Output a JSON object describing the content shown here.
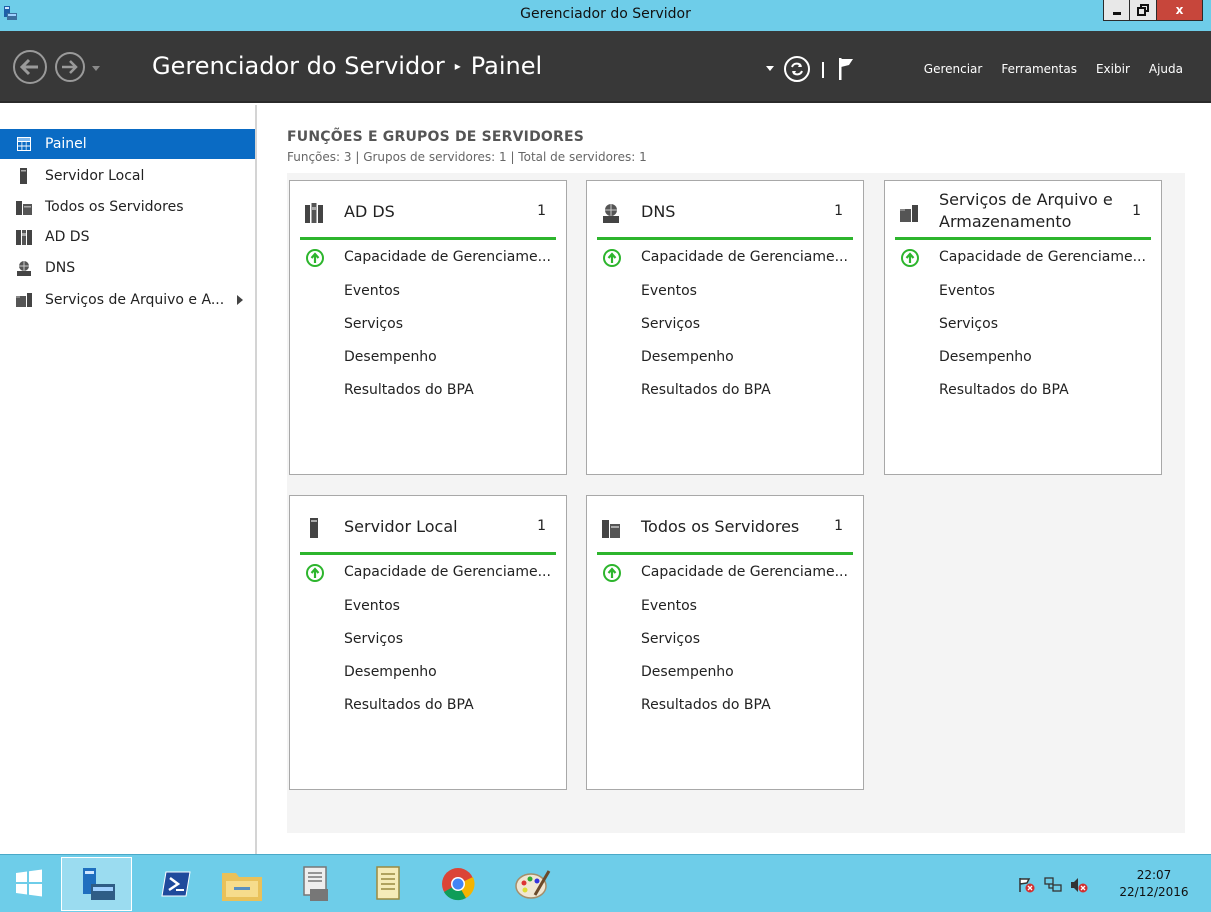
{
  "window": {
    "title": "Gerenciador do Servidor",
    "close_label": "x"
  },
  "header": {
    "breadcrumb_root": "Gerenciador do Servidor",
    "breadcrumb_sep": "▸",
    "breadcrumb_page": "Painel",
    "menu": [
      "Gerenciar",
      "Ferramentas",
      "Exibir",
      "Ajuda"
    ]
  },
  "sidebar": {
    "items": [
      {
        "label": "Painel",
        "icon": "dashboard-icon"
      },
      {
        "label": "Servidor Local",
        "icon": "server-icon"
      },
      {
        "label": "Todos os Servidores",
        "icon": "servers-icon"
      },
      {
        "label": "AD DS",
        "icon": "ad-ds-icon"
      },
      {
        "label": "DNS",
        "icon": "dns-icon"
      },
      {
        "label": "Serviços de Arquivo e A...",
        "icon": "file-services-icon"
      }
    ]
  },
  "main": {
    "section_title": "FUNÇÕES E GRUPOS DE SERVIDORES",
    "section_subtitle": "Funções: 3   |   Grupos de servidores: 1   |   Total de servidores: 1",
    "tiles": [
      {
        "name": "AD DS",
        "name_line2": "",
        "count": "1",
        "rows": [
          "Capacidade de Gerenciame...",
          "Eventos",
          "Serviços",
          "Desempenho",
          "Resultados do BPA"
        ]
      },
      {
        "name": "DNS",
        "name_line2": "",
        "count": "1",
        "rows": [
          "Capacidade de Gerenciame...",
          "Eventos",
          "Serviços",
          "Desempenho",
          "Resultados do BPA"
        ]
      },
      {
        "name": "Serviços de Arquivo e",
        "name_line2": "Armazenamento",
        "count": "1",
        "rows": [
          "Capacidade de Gerenciame...",
          "Eventos",
          "Serviços",
          "Desempenho",
          "Resultados do BPA"
        ]
      },
      {
        "name": "Servidor Local",
        "name_line2": "",
        "count": "1",
        "rows": [
          "Capacidade de Gerenciame...",
          "Eventos",
          "Serviços",
          "Desempenho",
          "Resultados do BPA"
        ]
      },
      {
        "name": "Todos os Servidores",
        "name_line2": "",
        "count": "1",
        "rows": [
          "Capacidade de Gerenciame...",
          "Eventos",
          "Serviços",
          "Desempenho",
          "Resultados do BPA"
        ]
      }
    ]
  },
  "taskbar": {
    "time": "22:07",
    "date": "22/12/2016"
  },
  "colors": {
    "accent": "#0a6bc4",
    "status_ok": "#2db52d",
    "taskbar": "#6ecde9",
    "header": "#383838"
  }
}
